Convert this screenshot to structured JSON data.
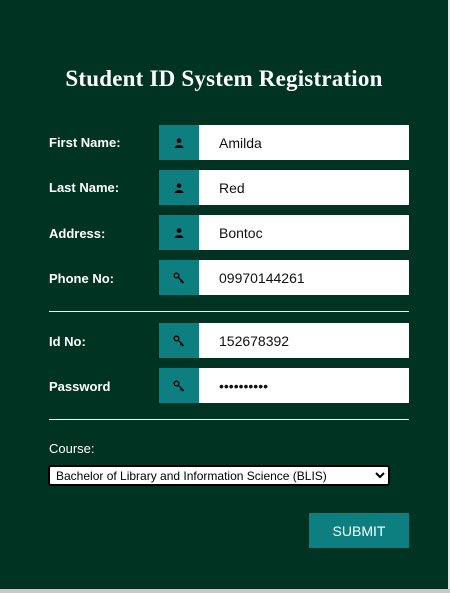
{
  "form": {
    "title": "Student ID System Registration",
    "fields": [
      {
        "label": "First Name:",
        "value": "Amilda",
        "icon": "user-icon"
      },
      {
        "label": "Last Name:",
        "value": "Red",
        "icon": "user-icon"
      },
      {
        "label": "Address:",
        "value": "Bontoc",
        "icon": "user-icon"
      },
      {
        "label": "Phone No:",
        "value": "09970144261",
        "icon": "key-icon"
      },
      {
        "label": "Id No:",
        "value": "152678392",
        "icon": "key-icon"
      },
      {
        "label": "Password",
        "value": "••••••••••",
        "icon": "key-icon"
      }
    ],
    "course": {
      "label": "Course:",
      "selected": "Bachelor of Library and Information Science (BLIS)"
    },
    "submit_label": "SUBMIT"
  },
  "colors": {
    "background": "#003322",
    "accent": "#0e7f80",
    "text": "#ffffff"
  }
}
